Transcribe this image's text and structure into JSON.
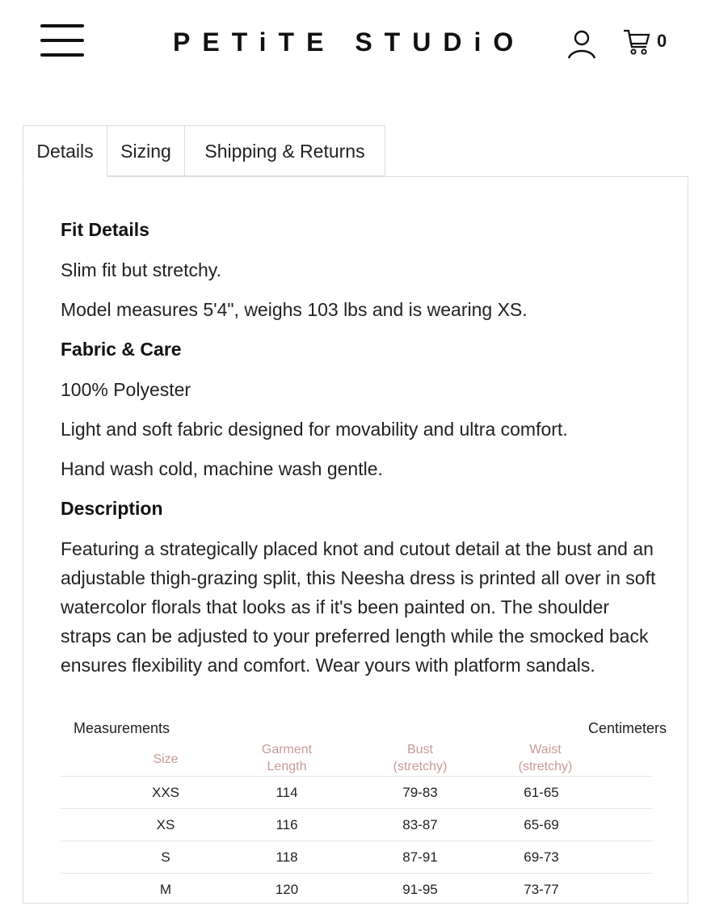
{
  "header": {
    "brand": "PETiTE STUDiO",
    "cart_count": "0",
    "icons": {
      "menu": "hamburger-menu-icon",
      "user": "user-icon",
      "cart": "cart-icon"
    }
  },
  "tabs": [
    {
      "label": "Details",
      "active": true
    },
    {
      "label": "Sizing",
      "active": false
    },
    {
      "label": "Shipping & Returns",
      "active": false
    }
  ],
  "details": {
    "fit_heading": "Fit Details",
    "fit_lines": [
      "Slim fit but stretchy.",
      "Model measures 5'4\", weighs 103 lbs and is wearing XS."
    ],
    "fabric_heading": "Fabric & Care",
    "fabric_lines": [
      "100% Polyester",
      "Light and soft fabric designed for movability and ultra comfort.",
      "Hand wash cold, machine wash gentle."
    ],
    "description_heading": "Description",
    "description": "Featuring a strategically placed knot and cutout detail at the bust and an adjustable thigh-grazing split, this Neesha dress is printed all over in soft watercolor florals that looks as if it's been painted on. The shoulder straps can be adjusted to your preferred length while the smocked back ensures flexibility and comfort. Wear yours with platform sandals."
  },
  "size_table": {
    "title": "Measurements",
    "unit": "Centimeters",
    "headers": [
      "Size",
      "Garment Length",
      "Bust (stretchy)",
      "Waist (stretchy)"
    ],
    "rows": [
      [
        "XXS",
        "114",
        "79-83",
        "61-65"
      ],
      [
        "XS",
        "116",
        "83-87",
        "65-69"
      ],
      [
        "S",
        "118",
        "87-91",
        "69-73"
      ],
      [
        "M",
        "120",
        "91-95",
        "73-77"
      ]
    ]
  },
  "colors": {
    "header_accent": "#c79a98",
    "border": "#dcdcdc"
  }
}
